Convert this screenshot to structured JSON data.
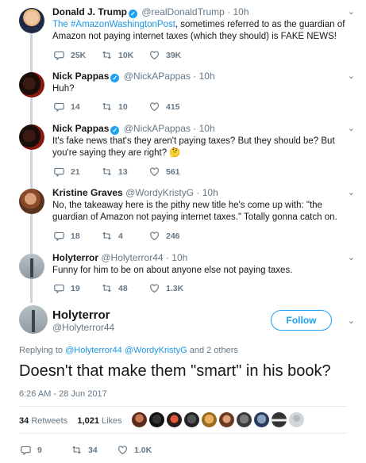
{
  "tweets": [
    {
      "name": "Donald J. Trump",
      "verified": true,
      "handle": "@realDonaldTrump",
      "dot": "·",
      "time": "10h",
      "text_link": "The #AmazonWashingtonPost",
      "text_rest": ", sometimes referred to as the guardian of Amazon not paying internet taxes (which they should) is FAKE NEWS!",
      "replies": "25K",
      "retweets": "10K",
      "likes": "39K"
    },
    {
      "name": "Nick Pappas",
      "verified": true,
      "handle": "@NickAPappas",
      "dot": "·",
      "time": "10h",
      "text": "Huh?",
      "replies": "14",
      "retweets": "10",
      "likes": "415"
    },
    {
      "name": "Nick Pappas",
      "verified": true,
      "handle": "@NickAPappas",
      "dot": "·",
      "time": "10h",
      "text": "It's fake news that's they aren't paying taxes? But they should be? But you're saying they are right? 🤔",
      "replies": "21",
      "retweets": "13",
      "likes": "561"
    },
    {
      "name": "Kristine Graves",
      "verified": false,
      "handle": "@WordyKristyG",
      "dot": "·",
      "time": "10h",
      "text": "No, the takeaway here is the pithy new title he's come up with: \"the guardian of Amazon not paying internet taxes.\" Totally gonna catch on.",
      "replies": "18",
      "retweets": "4",
      "likes": "246"
    },
    {
      "name": "Holyterror",
      "verified": false,
      "handle": "@Holyterror44",
      "dot": "·",
      "time": "10h",
      "text": "Funny for him to be on about anyone else not paying taxes.",
      "replies": "19",
      "retweets": "48",
      "likes": "1.3K"
    }
  ],
  "main": {
    "name": "Holyterror",
    "handle": "@Holyterror44",
    "follow_label": "Follow",
    "replying_prefix": "Replying to",
    "replying_users": "@Holyterror44 @WordyKristyG",
    "replying_suffix": "and 2 others",
    "text": "Doesn't that make them \"smart\" in his book?",
    "timestamp": "6:26 AM - 28 Jun 2017",
    "retweets_count": "34",
    "retweets_label": "Retweets",
    "likes_count": "1,021",
    "likes_label": "Likes",
    "replies": "9",
    "retweets": "34",
    "likes": "1.0K"
  },
  "icons": {
    "reply": "reply-icon",
    "retweet": "retweet-icon",
    "like": "heart-icon",
    "chevron": "chevron-down-icon",
    "verified": "verified-badge-icon"
  },
  "colors": {
    "accent": "#1da1f2",
    "link": "#1b95e0",
    "muted": "#657786",
    "text": "#14171a",
    "thread_line": "#ccd6dd"
  }
}
